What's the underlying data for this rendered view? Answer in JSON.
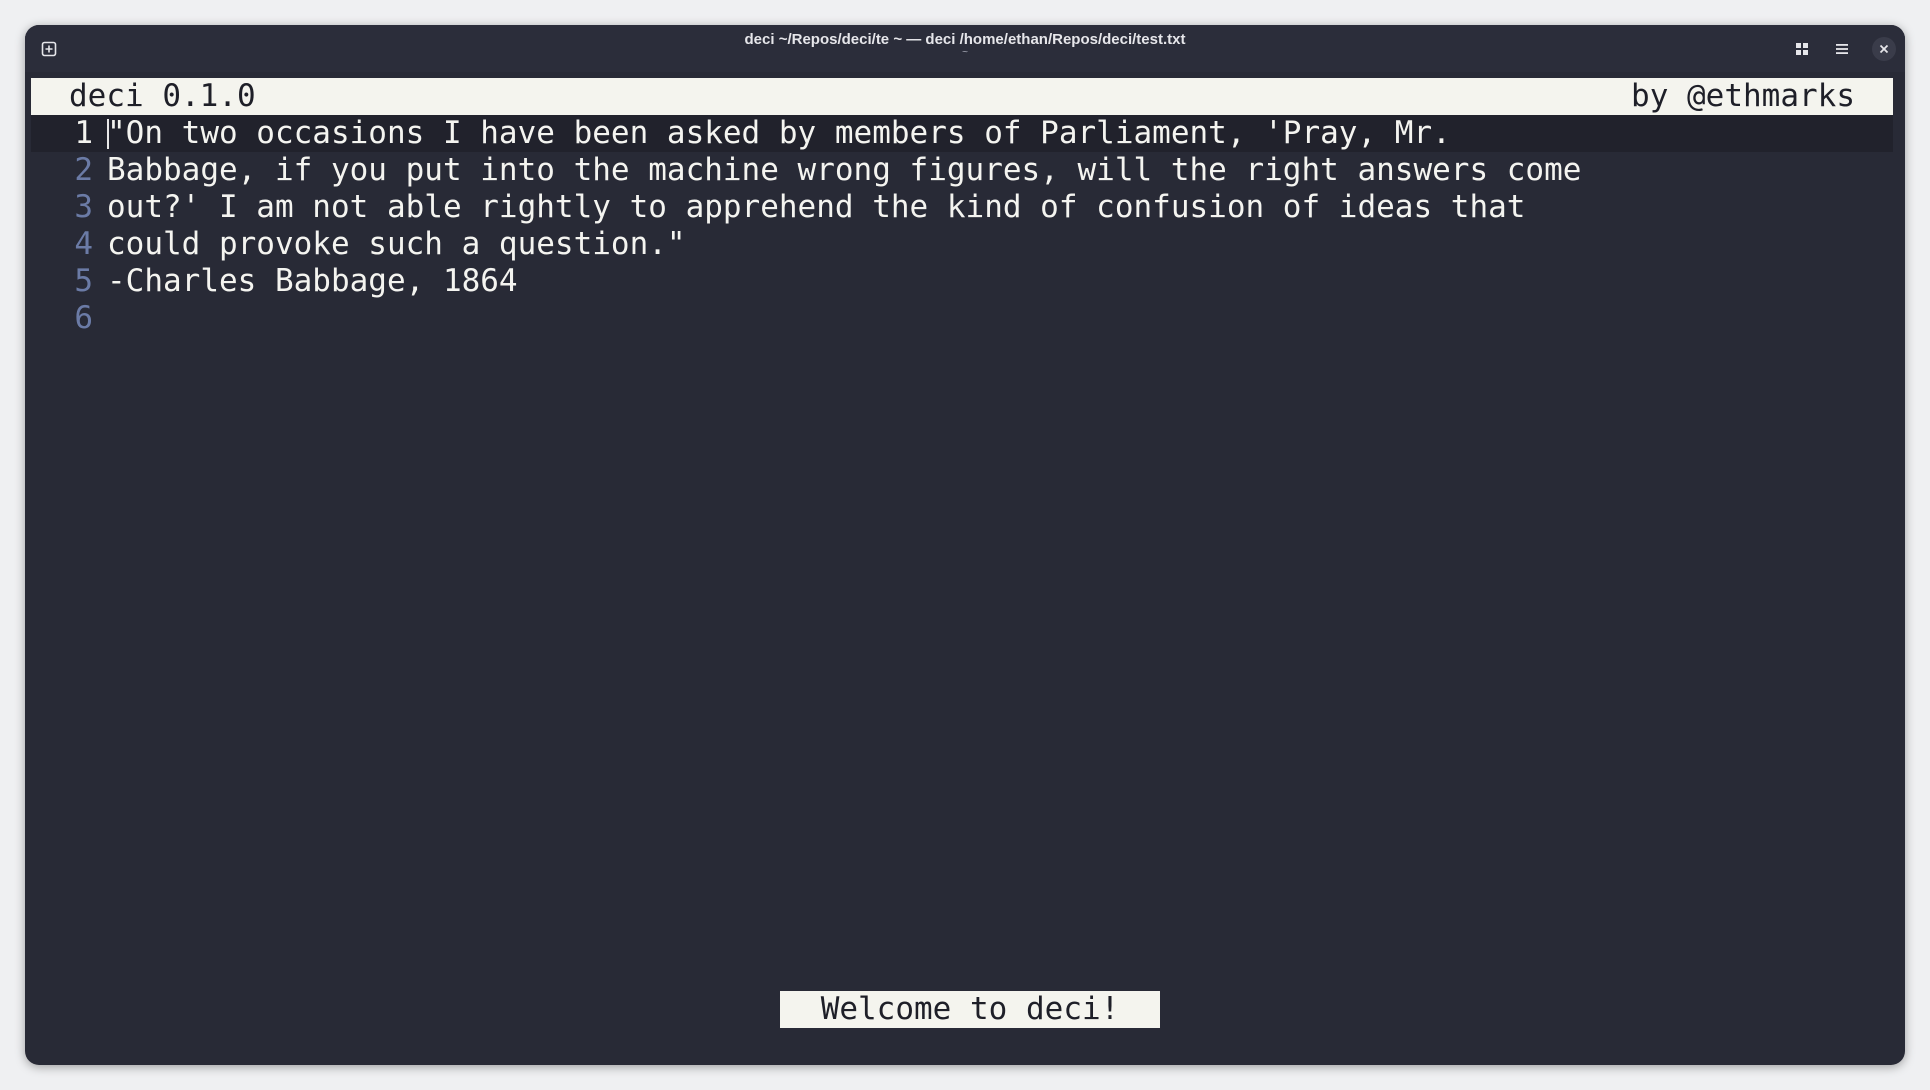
{
  "window": {
    "title": "deci ~/Repos/deci/te ~ — deci /home/ethan/Repos/deci/test.txt",
    "subtitle": "~"
  },
  "icons": {
    "new_tab": "new-tab-icon",
    "grid": "grid-view-icon",
    "menu": "hamburger-menu-icon",
    "close": "close-icon"
  },
  "editor": {
    "app_name": "deci 0.1.0",
    "author": "by @ethmarks",
    "lines": [
      {
        "number": "1",
        "text": "\"On two occasions I have been asked by members of Parliament, 'Pray, Mr."
      },
      {
        "number": "2",
        "text": "Babbage, if you put into the machine wrong figures, will the right answers come"
      },
      {
        "number": "3",
        "text": "out?' I am not able rightly to apprehend the kind of confusion of ideas that"
      },
      {
        "number": "4",
        "text": "could provoke such a question.\""
      },
      {
        "number": "5",
        "text": "-Charles Babbage, 1864"
      },
      {
        "number": "6",
        "text": ""
      }
    ],
    "current_line": 1,
    "status_message": "Welcome to deci!"
  },
  "colors": {
    "background": "#282a36",
    "bar": "#f4f4ee",
    "line_number": "#6b7ba6"
  }
}
